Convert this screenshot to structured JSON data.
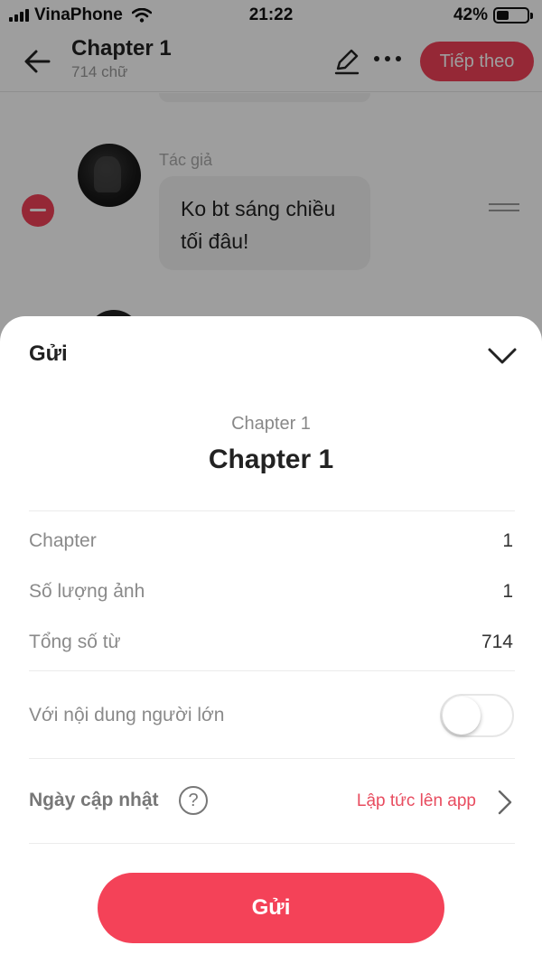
{
  "status_bar": {
    "carrier": "VinaPhone",
    "time": "21:22",
    "battery": "42%",
    "battery_level": 0.42
  },
  "nav": {
    "title": "Chapter 1",
    "subtitle": "714 chữ",
    "next_label": "Tiếp theo",
    "icons": [
      "back-arrow-icon",
      "pencil-icon",
      "more-icon"
    ]
  },
  "chat": {
    "author_label": "Tác giả",
    "message": "Ko bt sáng chiều tối đâu!"
  },
  "sheet": {
    "title": "Gửi",
    "caption": "Chapter 1",
    "heading": "Chapter 1",
    "rows": [
      {
        "label": "Chapter",
        "value": "1"
      },
      {
        "label": "Số lượng ảnh",
        "value": "1"
      },
      {
        "label": "Tổng số từ",
        "value": "714"
      }
    ],
    "adult_content_label": "Với nội dung người lớn",
    "adult_content_enabled": false,
    "update_label": "Ngày cập nhật",
    "help_symbol": "?",
    "update_value": "Lập tức lên app",
    "send_label": "Gửi"
  },
  "colors": {
    "accent": "#f44258",
    "link": "#e84c5f",
    "overlay": "rgba(0,0,0,0.38)"
  }
}
